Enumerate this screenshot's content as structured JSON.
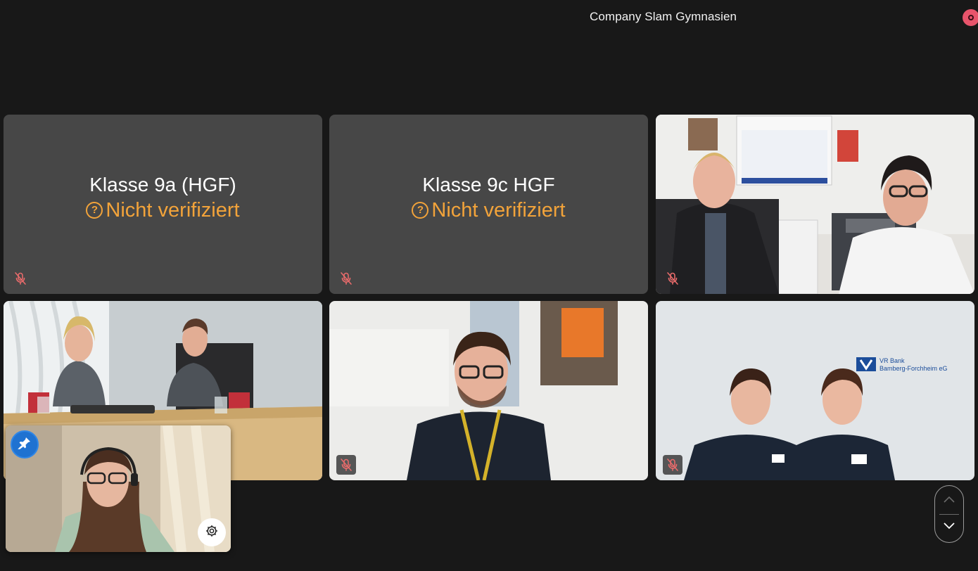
{
  "meeting": {
    "title": "Company Slam Gymnasien",
    "recording_indicator": {
      "icon": "record-icon",
      "color": "#e8546b"
    }
  },
  "tiles": [
    {
      "name": "Klasse 9a (HGF)",
      "status": "Nicht verifiziert",
      "type": "placeholder",
      "muted": true
    },
    {
      "name": "Klasse 9c HGF",
      "status": "Nicht verifiziert",
      "type": "placeholder",
      "muted": true
    },
    {
      "type": "video",
      "scene": "two people in office with calendar",
      "muted": true
    },
    {
      "type": "video",
      "scene": "two people at conference table",
      "muted": false
    },
    {
      "type": "video",
      "scene": "man with glasses and lanyard",
      "muted": true
    },
    {
      "type": "video",
      "scene": "two women in front of VR Bank logo",
      "muted": true,
      "logo_text": [
        "VR Bank",
        "Bamberg-Forchheim eG"
      ]
    }
  ],
  "self_view": {
    "pin_icon": "pin-icon",
    "settings_icon": "gear-icon"
  },
  "scroll_control": {
    "up_icon": "chevron-up-icon",
    "down_icon": "chevron-down-icon"
  },
  "colors": {
    "background": "#181818",
    "tile_background": "#474747",
    "warning": "#f2a33a",
    "muted_icon": "#e86b6b",
    "pin_blue": "#1f72d1"
  }
}
